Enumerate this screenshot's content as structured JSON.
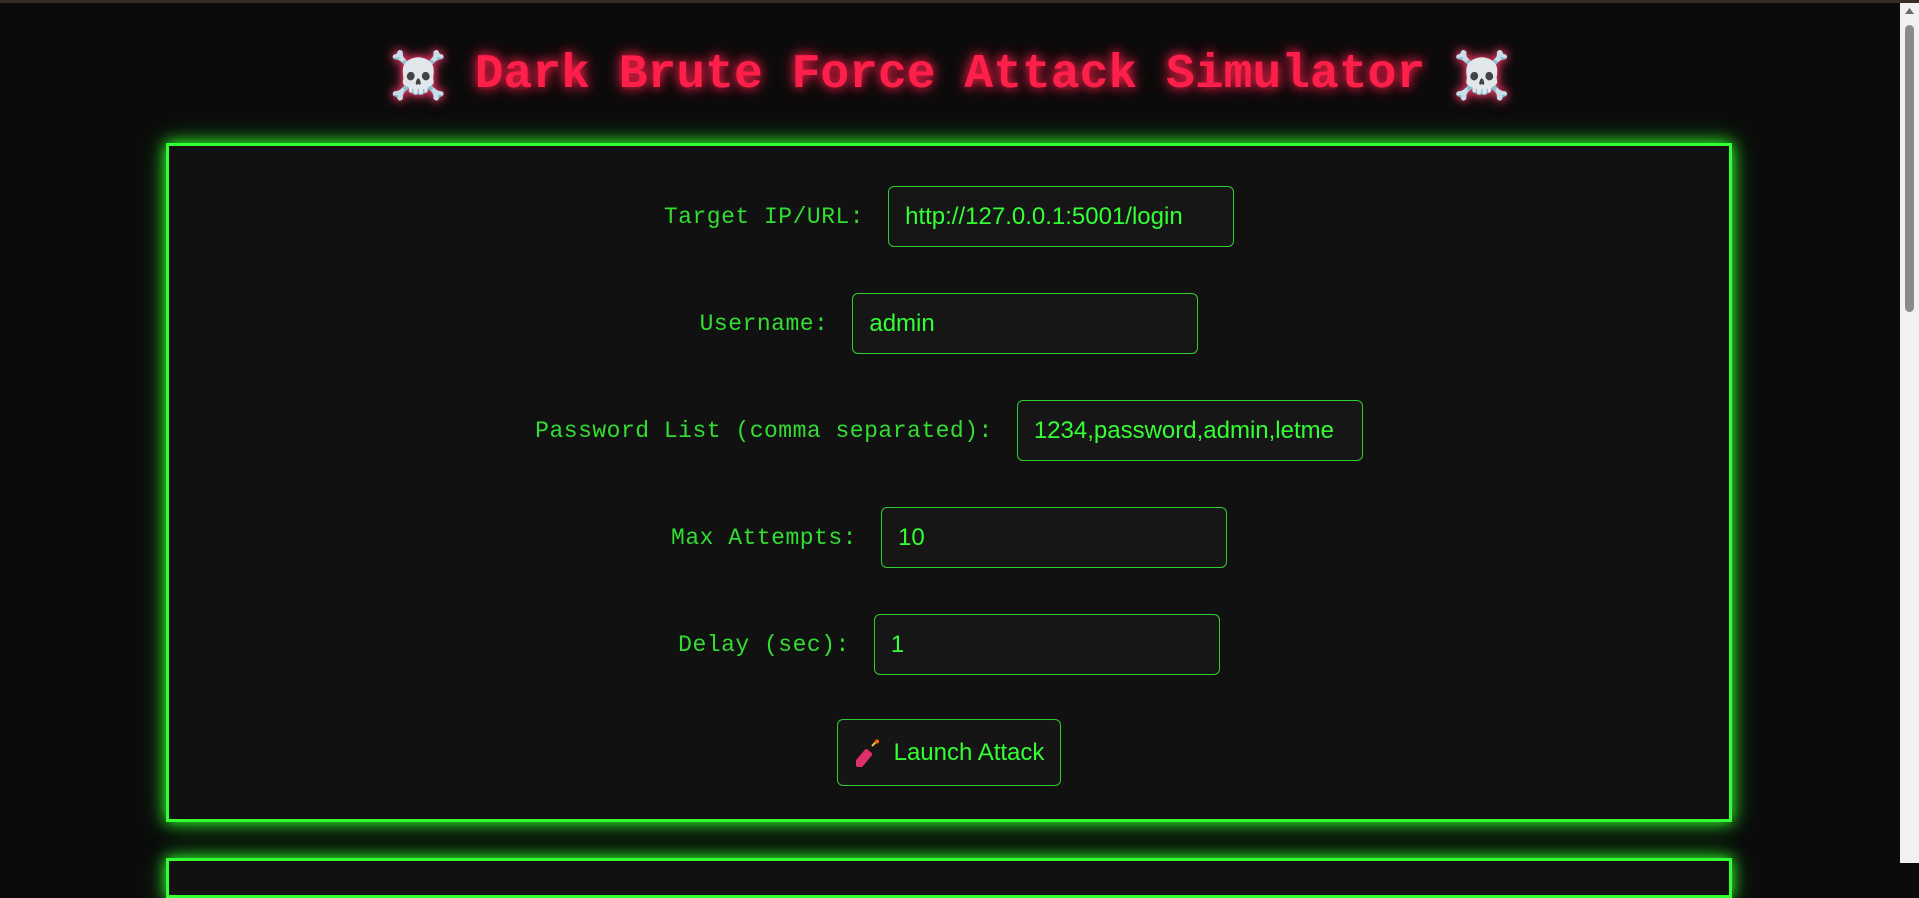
{
  "header": {
    "title": "Dark Brute Force Attack Simulator",
    "skull_left": "☠️",
    "skull_right": "☠️"
  },
  "form": {
    "target": {
      "label": "Target IP/URL:",
      "value": "http://127.0.0.1:5001/login"
    },
    "username": {
      "label": "Username:",
      "value": "admin"
    },
    "passwords": {
      "label": "Password List (comma separated):",
      "value": "1234,password,admin,letme"
    },
    "max_attempts": {
      "label": "Max Attempts:",
      "value": "10"
    },
    "delay": {
      "label": "Delay (sec):",
      "value": "1"
    },
    "launch_label": "Launch Attack"
  },
  "icons": {
    "skull": "skull-crossbones-icon",
    "launch": "dynamite-icon"
  },
  "colors": {
    "accent_green": "#33ff33",
    "title_red": "#ff1f4b",
    "background": "#0b0b0b",
    "panel": "#111111"
  }
}
